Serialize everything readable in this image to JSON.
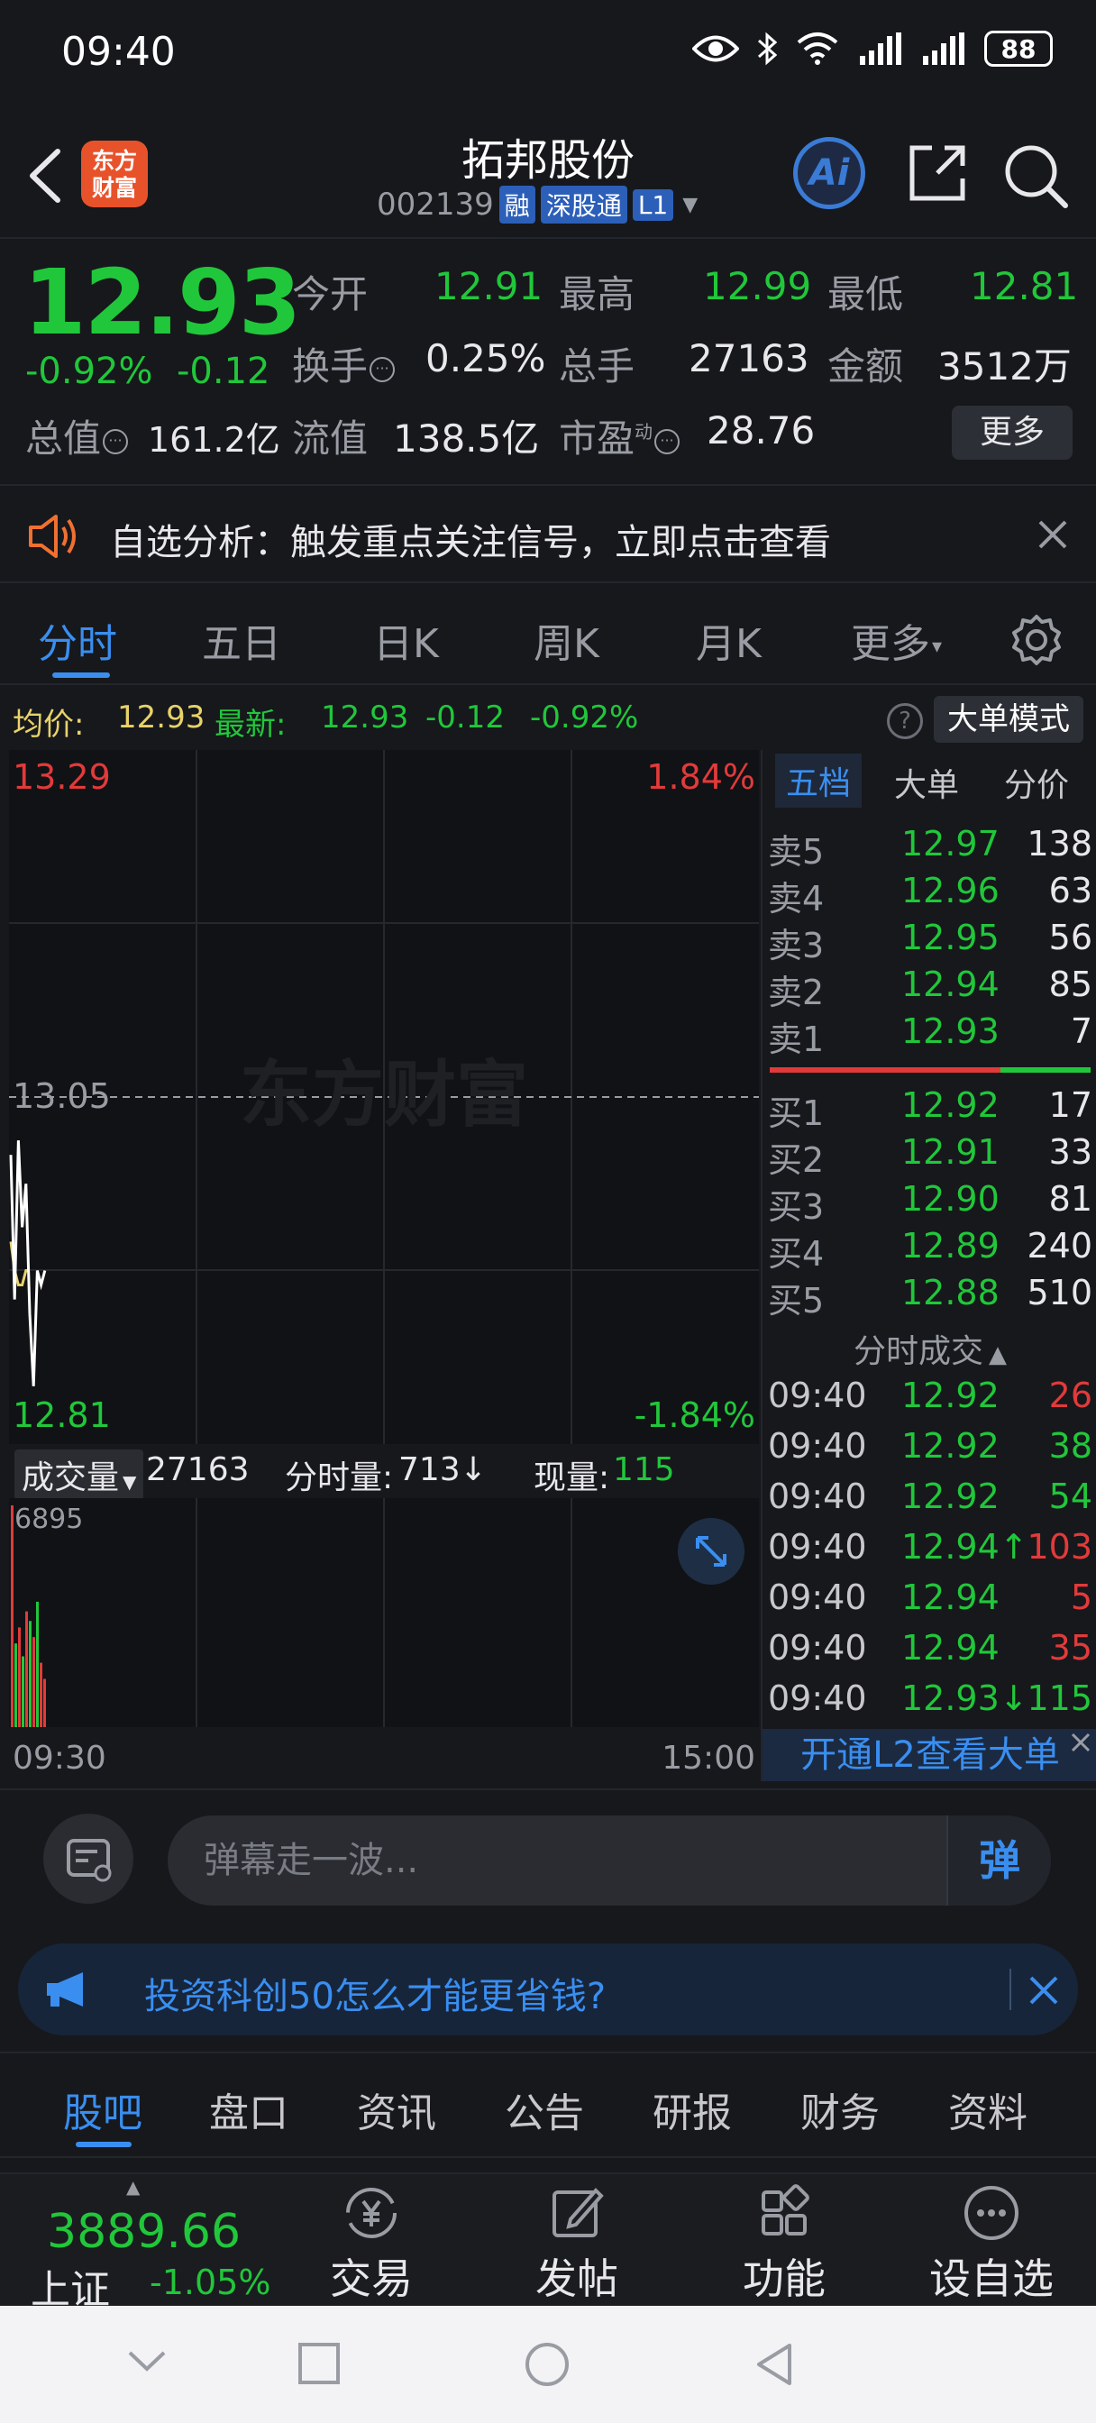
{
  "status": {
    "time": "09:40",
    "battery": "88"
  },
  "header": {
    "name": "拓邦股份",
    "code": "002139",
    "tags": [
      "融",
      "深股通",
      "L1"
    ],
    "logo_text": [
      "东方",
      "财富"
    ],
    "ai_label": "Ai"
  },
  "quote": {
    "price": "12.93",
    "change_pct": "-0.92%",
    "change": "-0.12",
    "open_label": "今开",
    "open": "12.91",
    "high_label": "最高",
    "high": "12.99",
    "low_label": "最低",
    "low": "12.81",
    "turnover_label": "换手",
    "turnover": "0.25%",
    "volume_label": "总手",
    "volume": "27163",
    "amount_label": "金额",
    "amount": "3512万",
    "mktcap_label": "总值",
    "mktcap": "161.2亿",
    "float_label": "流值",
    "float_cap": "138.5亿",
    "pe_label": "市盈",
    "pe_sup": "动",
    "pe": "28.76",
    "more": "更多"
  },
  "alert": {
    "text": "自选分析：触发重点关注信号，立即点击查看"
  },
  "tabs": [
    "分时",
    "五日",
    "日K",
    "周K",
    "月K",
    "更多"
  ],
  "avg_row": {
    "avg_label": "均价:",
    "avg": "12.93",
    "latest_label": "最新:",
    "latest": "12.93",
    "chg": "-0.12",
    "pct": "-0.92%",
    "big_order_mode": "大单模式"
  },
  "chart": {
    "y_top": "13.29",
    "y_mid": "13.05",
    "y_bottom": "12.81",
    "pct_top": "1.84%",
    "pct_bottom": "-1.84%",
    "watermark": "东方财富",
    "time_start": "09:30",
    "time_end": "15:00",
    "price_series": [
      13.01,
      12.91,
      13.02,
      12.96,
      12.99,
      12.9,
      12.85,
      12.93,
      12.92,
      12.93
    ],
    "avg_series": [
      12.95,
      12.93,
      12.92,
      12.92,
      12.93,
      12.93
    ]
  },
  "volume": {
    "select_label": "成交量",
    "total": "27163",
    "minute_label": "分时量:",
    "minute": "713",
    "minute_arrow": "↓",
    "now_label": "现量:",
    "now": "115",
    "max_label": "6895",
    "bars": [
      {
        "v": 6895,
        "c": "#e23a3a"
      },
      {
        "v": 2600,
        "c": "#21c73a"
      },
      {
        "v": 3100,
        "c": "#e23a3a"
      },
      {
        "v": 2200,
        "c": "#21c73a"
      },
      {
        "v": 3600,
        "c": "#e23a3a"
      },
      {
        "v": 3300,
        "c": "#21c73a"
      },
      {
        "v": 2800,
        "c": "#e23a3a"
      },
      {
        "v": 3900,
        "c": "#21c73a"
      },
      {
        "v": 2000,
        "c": "#e23a3a"
      },
      {
        "v": 1500,
        "c": "#e23a3a"
      }
    ]
  },
  "orderbook": {
    "tabs": [
      "五档",
      "大单",
      "分价"
    ],
    "asks": [
      {
        "k": "卖5",
        "p": "12.97",
        "v": "138"
      },
      {
        "k": "卖4",
        "p": "12.96",
        "v": "63"
      },
      {
        "k": "卖3",
        "p": "12.95",
        "v": "56"
      },
      {
        "k": "卖2",
        "p": "12.94",
        "v": "85"
      },
      {
        "k": "卖1",
        "p": "12.93",
        "v": "7"
      }
    ],
    "bids": [
      {
        "k": "买1",
        "p": "12.92",
        "v": "17"
      },
      {
        "k": "买2",
        "p": "12.91",
        "v": "33"
      },
      {
        "k": "买3",
        "p": "12.90",
        "v": "81"
      },
      {
        "k": "买4",
        "p": "12.89",
        "v": "240"
      },
      {
        "k": "买5",
        "p": "12.88",
        "v": "510"
      }
    ],
    "trades_title": "分时成交",
    "trades": [
      {
        "t": "09:40",
        "p": "12.92",
        "v": "26",
        "c": "#e23a3a"
      },
      {
        "t": "09:40",
        "p": "12.92",
        "v": "38",
        "c": "#21c73a"
      },
      {
        "t": "09:40",
        "p": "12.92",
        "v": "54",
        "c": "#21c73a"
      },
      {
        "t": "09:40",
        "p": "12.94↑",
        "v": "103",
        "c": "#e23a3a"
      },
      {
        "t": "09:40",
        "p": "12.94",
        "v": "5",
        "c": "#e23a3a"
      },
      {
        "t": "09:40",
        "p": "12.94",
        "v": "35",
        "c": "#e23a3a"
      },
      {
        "t": "09:40",
        "p": "12.93↓",
        "v": "115",
        "c": "#21c73a"
      }
    ],
    "l2_banner": "开通L2查看大单"
  },
  "barrage": {
    "placeholder": "弹幕走一波...",
    "danmu": "弹"
  },
  "ad": {
    "text": "投资科创50怎么才能更省钱?"
  },
  "info_tabs": [
    "股吧",
    "盘口",
    "资讯",
    "公告",
    "研报",
    "财务",
    "资料"
  ],
  "bottom": {
    "index_value": "3889.66",
    "index_name": "上证",
    "index_change": "-1.05%",
    "nav": [
      "交易",
      "发帖",
      "功能",
      "设自选"
    ]
  },
  "colors": {
    "up": "#e23a3a",
    "down": "#21c73a",
    "accent": "#3a8ef0",
    "price_line": "#ffffff",
    "avg_line": "#e8d26a"
  }
}
